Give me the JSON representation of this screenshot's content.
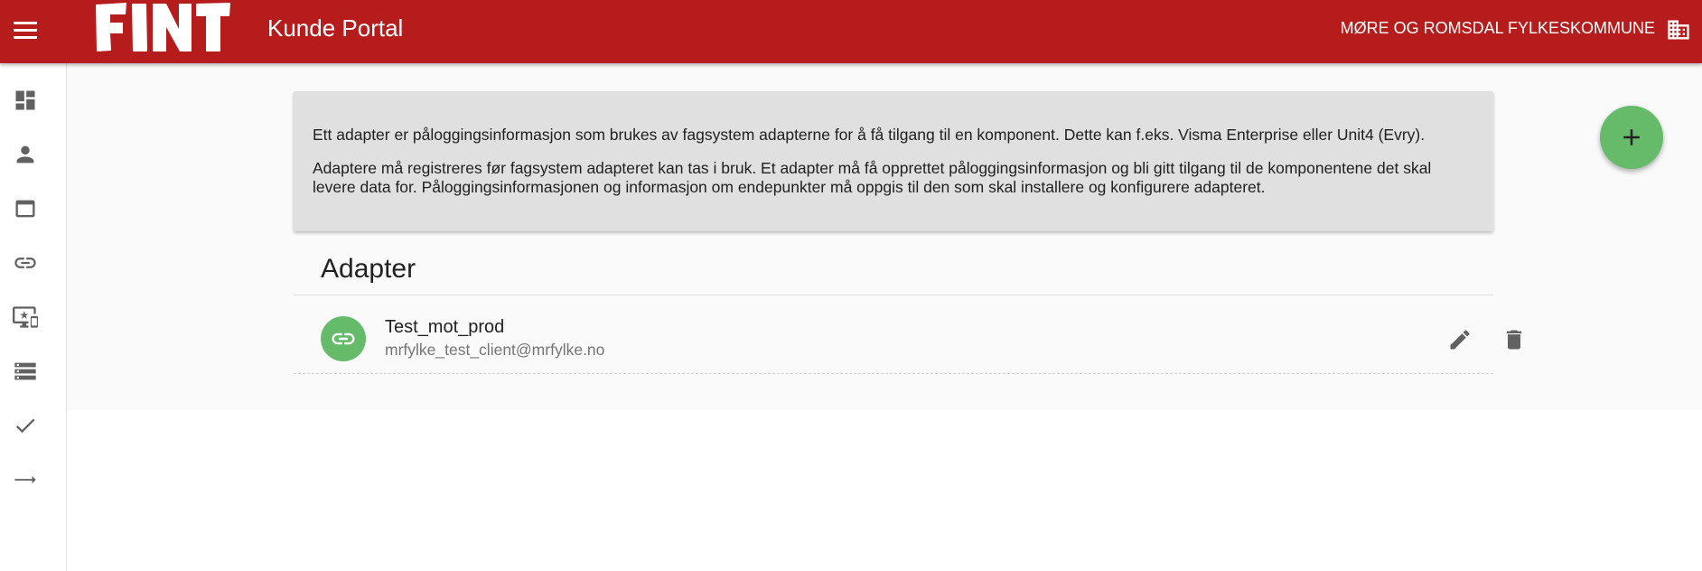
{
  "header": {
    "logo_text": "FINT",
    "app_title": "Kunde Portal",
    "organization": "MØRE OG ROMSDAL FYLKESKOMMUNE",
    "background_color": "#b71c1c"
  },
  "sidebar": {
    "items": [
      {
        "icon": "dashboard-icon"
      },
      {
        "icon": "person-icon"
      },
      {
        "icon": "web-asset-icon"
      },
      {
        "icon": "link-icon"
      },
      {
        "icon": "important-devices-icon"
      },
      {
        "icon": "storage-icon"
      },
      {
        "icon": "check-icon"
      },
      {
        "icon": "arrow-right-icon"
      }
    ]
  },
  "info": {
    "paragraph1": "Ett adapter er påloggingsinformasjon som brukes av fagsystem adapterne for å få tilgang til en komponent. Dette kan f.eks. Visma Enterprise eller Unit4 (Evry).",
    "paragraph2": "Adaptere må registreres før fagsystem adapteret kan tas i bruk. Et adapter må få opprettet påloggingsinformasjon og bli gitt tilgang til de komponentene det skal levere data for. Påloggingsinformasjonen og informasjon om endepunkter må oppgis til den som skal installere og konfigurere adapteret."
  },
  "adapters": {
    "title": "Adapter",
    "items": [
      {
        "name": "Test_mot_prod",
        "client": "mrfylke_test_client@mrfylke.no"
      }
    ]
  },
  "colors": {
    "accent_green": "#66bb6a"
  },
  "fab": {
    "icon": "add-icon"
  }
}
